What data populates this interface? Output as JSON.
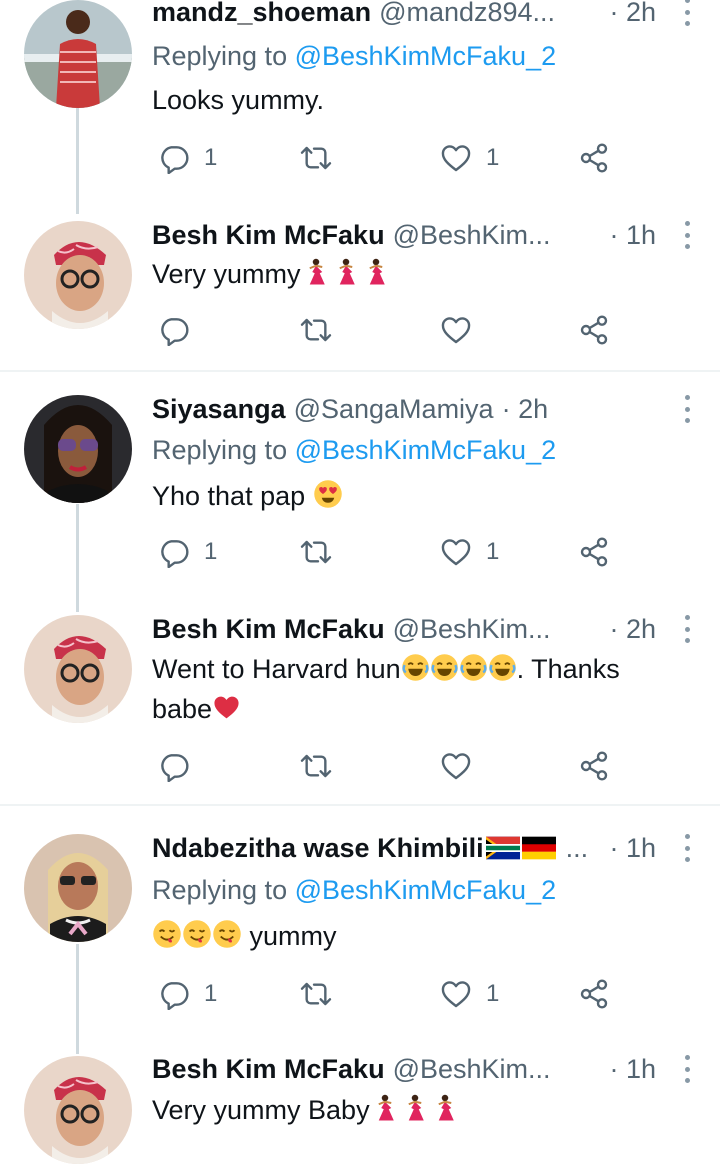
{
  "replying_label": "Replying to",
  "tweets": [
    {
      "name": "mandz_shoeman",
      "handle": "@mandz894...",
      "time": "· 2h",
      "replying_to": "@BeshKimMcFaku_2",
      "text": "Looks yummy.",
      "replies": "1",
      "likes": "1"
    },
    {
      "name": "Besh Kim McFaku",
      "handle": "@BeshKim...",
      "time": "· 1h",
      "text": "Very yummy",
      "emojis": [
        "dancer-emoji",
        "dancer-emoji",
        "dancer-emoji"
      ],
      "replies": "",
      "likes": ""
    },
    {
      "name": "Siyasanga",
      "handle": "@SangaMamiya",
      "time": "· 2h",
      "replying_to": "@BeshKimMcFaku_2",
      "text": "Yho that pap",
      "emojis": [
        "heart-eyes-emoji"
      ],
      "replies": "1",
      "likes": "1"
    },
    {
      "name": "Besh Kim McFaku",
      "handle": "@BeshKim...",
      "time": "· 2h",
      "text_line1_a": "Went to Harvard hun",
      "text_line1_b": ". Thanks",
      "text_line2": "babe",
      "emojis": [
        "joy-emoji",
        "joy-emoji",
        "joy-emoji",
        "joy-emoji",
        "red-heart-emoji"
      ],
      "replies": "",
      "likes": ""
    },
    {
      "name": "Ndabezitha wase Khimbili",
      "handle": "...",
      "time": "· 1h",
      "flags": [
        "south-africa-flag",
        "germany-flag"
      ],
      "replying_to": "@BeshKimMcFaku_2",
      "text": "yummy",
      "emojis": [
        "yum-emoji",
        "yum-emoji",
        "yum-emoji"
      ],
      "replies": "1",
      "likes": "1"
    },
    {
      "name": "Besh Kim McFaku",
      "handle": "@BeshKim...",
      "time": "· 1h",
      "text": "Very yummy Baby",
      "emojis": [
        "dancer-emoji",
        "dancer-emoji",
        "dancer-emoji"
      ]
    }
  ],
  "icons": {
    "reply": "reply-icon",
    "retweet": "retweet-icon",
    "like": "like-icon",
    "share": "share-icon",
    "more": "more-options-icon"
  },
  "colors": {
    "link": "#1d9bf0",
    "secondary_text": "#536471",
    "thread_line": "#cfd9de",
    "divider": "#eff3f4"
  }
}
